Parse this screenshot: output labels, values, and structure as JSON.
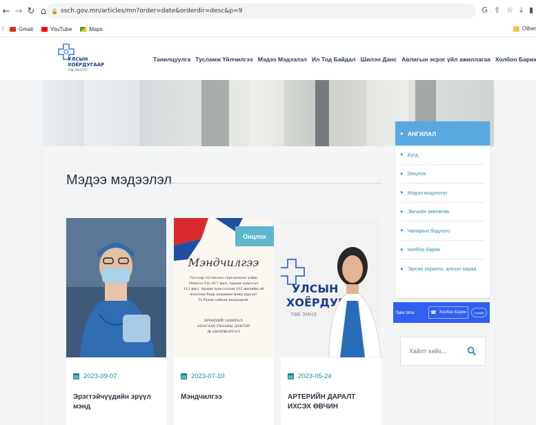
{
  "browser": {
    "url": "ssch.gov.mn/articles/mn?order=date&orderdir=desc&p=9",
    "bookmarks": [
      {
        "label": "Gmail",
        "color": "#d93025"
      },
      {
        "label": "YouTube",
        "color": "#ff0000"
      },
      {
        "label": "Maps",
        "color": "#34a853"
      }
    ],
    "other_bookmarks": "Other"
  },
  "site": {
    "logo_title": "УЛСЫН ХОЁРДУГААР",
    "logo_subtitle": "ТӨВ ЭМНЭЛЭГ",
    "nav": [
      "Танилцуулга",
      "Тусламж Үйлчилгээ",
      "Мэдээ Мэдээлэл",
      "Ил Тод Байдал",
      "Шилэн Данс",
      "Авлигын эсрэг үйл ажиллагаа",
      "Холбоо Барих"
    ]
  },
  "main": {
    "section_title": "Мэдээ мэдээлэл",
    "cards": [
      {
        "date": "2023-09-07",
        "title": "Эрэгтэйчүүдийн эрүүл мэнд"
      },
      {
        "date": "2023-07-10",
        "title": "Мэндчилгээ",
        "badge": "Онцлох"
      },
      {
        "date": "2023-05-24",
        "title": "АРТЕРИЙН ДАРАЛТ ИХСЭХ ӨВЧИН"
      }
    ]
  },
  "sidebar": {
    "heading": "АНГИЛАЛ",
    "items": [
      "Бүгд",
      "Онцлох",
      "Мэдээ мэдээлэл",
      "Эмчийн зөвлөгөө",
      "Чанарын бодлого",
      "холбоо барих",
      "Эрхэм зорилго, алсын хараа"
    ]
  },
  "take_time": {
    "label": "Take time",
    "button": "Холбоо Барих",
    "small_button": "Онлайн"
  },
  "search": {
    "placeholder": "Хайлт хийх..."
  },
  "colors": {
    "accent": "#0f8b8d",
    "sidebar_head": "#5aa8e0",
    "take_time_bg": "#3160f0",
    "logo_blue": "#1b3e8b"
  }
}
